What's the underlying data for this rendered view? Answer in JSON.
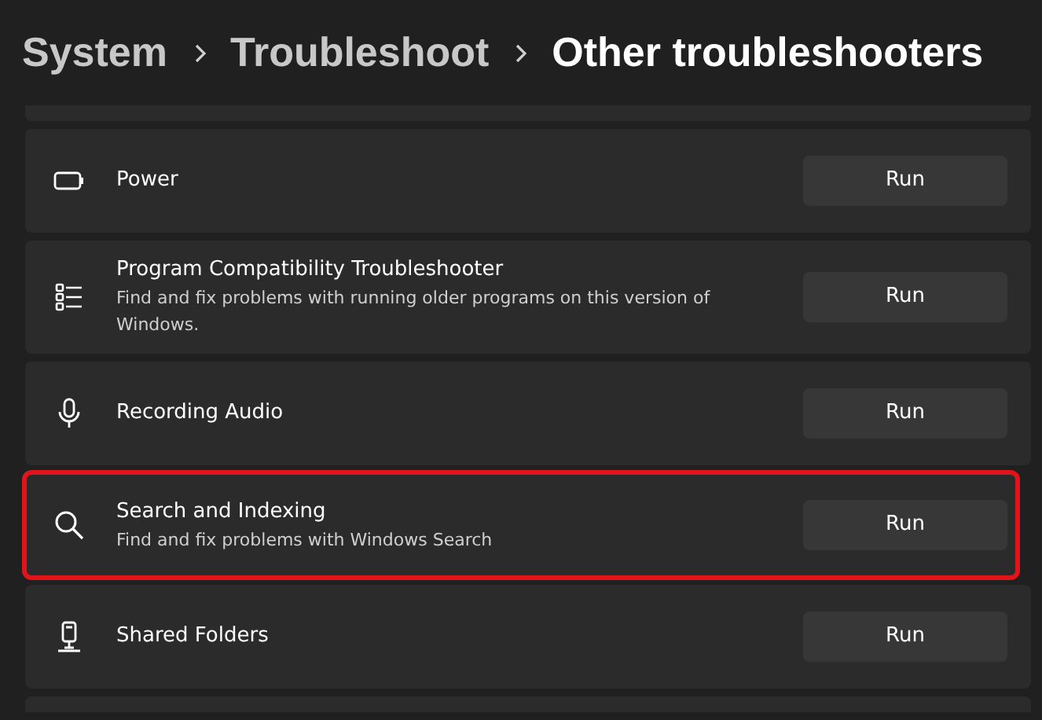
{
  "breadcrumb": [
    {
      "label": "System",
      "current": false
    },
    {
      "label": "Troubleshoot",
      "current": false
    },
    {
      "label": "Other troubleshooters",
      "current": true
    }
  ],
  "troubleshooters": [
    {
      "kind": "battery",
      "title": "Power",
      "button": "Run",
      "highlighted": false
    },
    {
      "kind": "list",
      "title": "Program Compatibility Troubleshooter",
      "description": "Find and fix problems with running older programs on this version of Windows.",
      "button": "Run",
      "highlighted": false
    },
    {
      "kind": "mic",
      "title": "Recording Audio",
      "button": "Run",
      "highlighted": false
    },
    {
      "kind": "search",
      "title": "Search and Indexing",
      "description": "Find and fix problems with Windows Search",
      "button": "Run",
      "highlighted": true
    },
    {
      "kind": "shared",
      "title": "Shared Folders",
      "button": "Run",
      "highlighted": false
    }
  ]
}
